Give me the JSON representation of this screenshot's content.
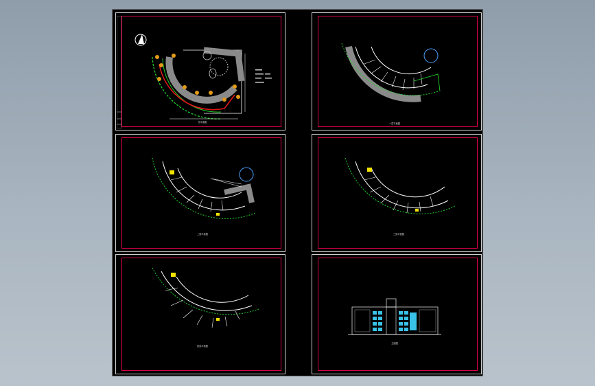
{
  "viewer": {
    "background_color": "#9aa6b2",
    "drawing_background": "#000000",
    "frame_color": "#d8004c",
    "wall_color": "#22d12c"
  },
  "sheets": [
    {
      "id": "site-plan",
      "caption": "总平面图"
    },
    {
      "id": "first-floor-plan",
      "caption": "一层平面图"
    },
    {
      "id": "second-floor-plan",
      "caption": "二层平面图"
    },
    {
      "id": "third-floor-plan",
      "caption": "三层平面图"
    },
    {
      "id": "fourth-floor-plan",
      "caption": "四层平面图"
    },
    {
      "id": "elevation",
      "caption": "立面图"
    }
  ]
}
